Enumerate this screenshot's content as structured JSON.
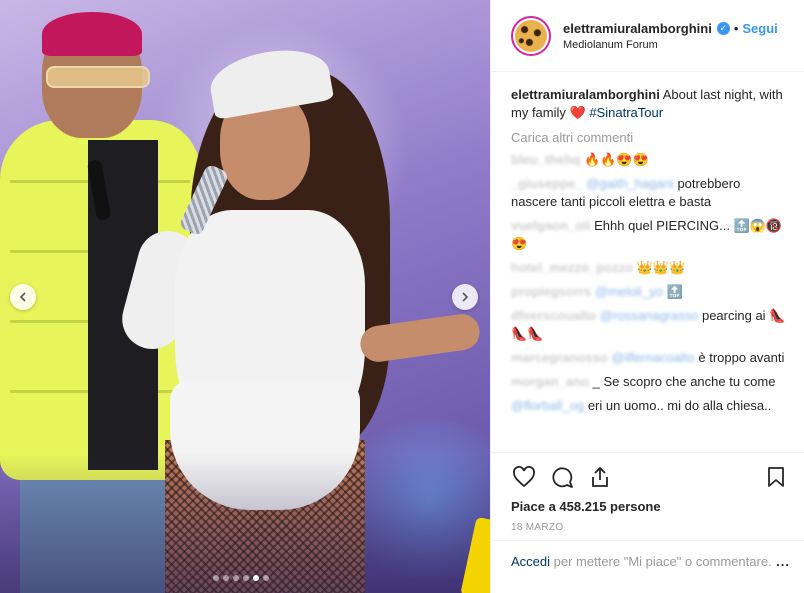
{
  "post": {
    "carousel": {
      "dot_count": 6,
      "active_index": 4
    }
  },
  "header": {
    "username": "elettramiuralamborghini",
    "separator": "•",
    "follow_label": "Segui",
    "location": "Mediolanum Forum"
  },
  "caption": {
    "username": "elettramiuralamborghini",
    "text_before": "About last night, with my family",
    "heart": "❤️",
    "hashtag": "#SinatraTour"
  },
  "load_more": "Carica altri commenti",
  "comments": [
    {
      "user": "bleu_thehq",
      "mention": "",
      "text": "🔥🔥😍😍"
    },
    {
      "user": "_giuseppe_",
      "mention": "@gaith_hagani",
      "text": "potrebbero nascere tanti piccoli elettra e basta"
    },
    {
      "user": "vuelgaon_oli",
      "mention": "",
      "text": "Ehhh quel PIERCING... 🔝😱🔞😍"
    },
    {
      "user": "hotel_mezzo_pozzo",
      "mention": "",
      "text": "👑👑👑"
    },
    {
      "user": "propiegsorrs",
      "mention": "@meloli_yo",
      "text": "🔝"
    },
    {
      "user": "dfeerscoualto",
      "mention": "@rossanagrasso",
      "text": "pearcing ai 👠👠👠"
    },
    {
      "user": "marcegranosso",
      "mention": "@ilfernacoalto",
      "text": "è troppo avanti"
    },
    {
      "user": "morgan_ano",
      "mention": "",
      "text": "_ Se scopro che anche tu come"
    },
    {
      "user": "",
      "mention": "@florball_og",
      "text": "eri un uomo.. mi do alla chiesa.."
    }
  ],
  "actions": {
    "likes_label": "Piace a 458.215 persone",
    "date": "18 MARZO"
  },
  "login": {
    "link": "Accedi",
    "text": " per mettere \"Mi piace\" o commentare.",
    "more": "..."
  },
  "colors": {
    "accent": "#3897f0",
    "heart": "#ed1c24",
    "hashtag": "#003569",
    "muted": "#999999"
  }
}
